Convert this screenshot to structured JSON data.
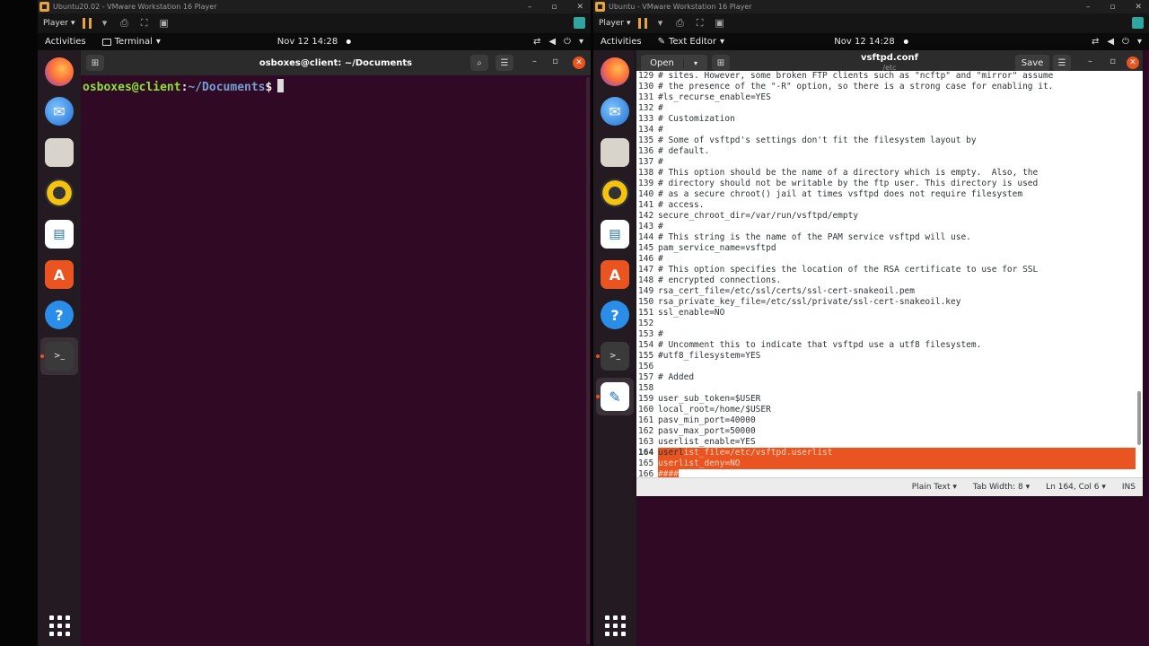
{
  "left_vm": {
    "window_title": "Ubuntu20.02 - VMware Workstation 16 Player",
    "player_menu": "Player",
    "topbar": {
      "activities": "Activities",
      "app_name": "Terminal",
      "clock": "Nov 12  14:28"
    },
    "terminal": {
      "title": "osboxes@client: ~/Documents",
      "prompt_user": "osboxes@client",
      "prompt_colon": ":",
      "prompt_path": "~/Documents",
      "prompt_sign": "$"
    }
  },
  "right_vm": {
    "window_title": "Ubuntu - VMware Workstation 16 Player",
    "player_menu": "Player",
    "topbar": {
      "activities": "Activities",
      "app_name": "Text Editor",
      "clock": "Nov 12  14:28"
    },
    "editor": {
      "open_label": "Open",
      "filename": "vsftpd.conf",
      "path": "/etc",
      "save_label": "Save",
      "status": {
        "language": "Plain Text",
        "tab_width": "Tab Width: 8",
        "position": "Ln 164, Col 6",
        "mode": "INS"
      },
      "lines": [
        {
          "n": "129",
          "t": "# sites. However, some broken FTP clients such as \"ncftp\" and \"mirror\" assume"
        },
        {
          "n": "130",
          "t": "# the presence of the \"-R\" option, so there is a strong case for enabling it."
        },
        {
          "n": "131",
          "t": "#ls_recurse_enable=YES"
        },
        {
          "n": "132",
          "t": "#"
        },
        {
          "n": "133",
          "t": "# Customization"
        },
        {
          "n": "134",
          "t": "#"
        },
        {
          "n": "135",
          "t": "# Some of vsftpd's settings don't fit the filesystem layout by"
        },
        {
          "n": "136",
          "t": "# default."
        },
        {
          "n": "137",
          "t": "#"
        },
        {
          "n": "138",
          "t": "# This option should be the name of a directory which is empty.  Also, the"
        },
        {
          "n": "139",
          "t": "# directory should not be writable by the ftp user. This directory is used"
        },
        {
          "n": "140",
          "t": "# as a secure chroot() jail at times vsftpd does not require filesystem"
        },
        {
          "n": "141",
          "t": "# access."
        },
        {
          "n": "142",
          "t": "secure_chroot_dir=/var/run/vsftpd/empty"
        },
        {
          "n": "143",
          "t": "#"
        },
        {
          "n": "144",
          "t": "# This string is the name of the PAM service vsftpd will use."
        },
        {
          "n": "145",
          "t": "pam_service_name=vsftpd"
        },
        {
          "n": "146",
          "t": "#"
        },
        {
          "n": "147",
          "t": "# This option specifies the location of the RSA certificate to use for SSL"
        },
        {
          "n": "148",
          "t": "# encrypted connections."
        },
        {
          "n": "149",
          "t": "rsa_cert_file=/etc/ssl/certs/ssl-cert-snakeoil.pem"
        },
        {
          "n": "150",
          "t": "rsa_private_key_file=/etc/ssl/private/ssl-cert-snakeoil.key"
        },
        {
          "n": "151",
          "t": "ssl_enable=NO"
        },
        {
          "n": "152",
          "t": ""
        },
        {
          "n": "153",
          "t": "#"
        },
        {
          "n": "154",
          "t": "# Uncomment this to indicate that vsftpd use a utf8 filesystem."
        },
        {
          "n": "155",
          "t": "#utf8_filesystem=YES"
        },
        {
          "n": "156",
          "t": ""
        },
        {
          "n": "157",
          "t": "# Added"
        },
        {
          "n": "158",
          "t": ""
        },
        {
          "n": "159",
          "t": "user_sub_token=$USER"
        },
        {
          "n": "160",
          "t": "local_root=/home/$USER"
        },
        {
          "n": "161",
          "t": "pasv_min_port=40000"
        },
        {
          "n": "162",
          "t": "pasv_max_port=50000"
        },
        {
          "n": "163",
          "t": "userlist_enable=YES"
        },
        {
          "n": "164",
          "t": "userl",
          "sel": "ist_file=/etc/vsftpd.userlist",
          "current": true,
          "fullsel": true
        },
        {
          "n": "165",
          "t": "",
          "sel": "userlist_deny=NO",
          "fullsel": true
        },
        {
          "n": "166",
          "t": "",
          "sel": "####"
        }
      ]
    }
  },
  "dock_icons": [
    "firefox-icon",
    "thunderbird-icon",
    "files-icon",
    "rhythmbox-icon",
    "writer-icon",
    "software-icon",
    "help-icon",
    "terminal-icon"
  ],
  "colors": {
    "accent": "#e95420",
    "terminal_bg": "#300a24",
    "prompt_user": "#8ae234",
    "prompt_path": "#729fcf"
  }
}
